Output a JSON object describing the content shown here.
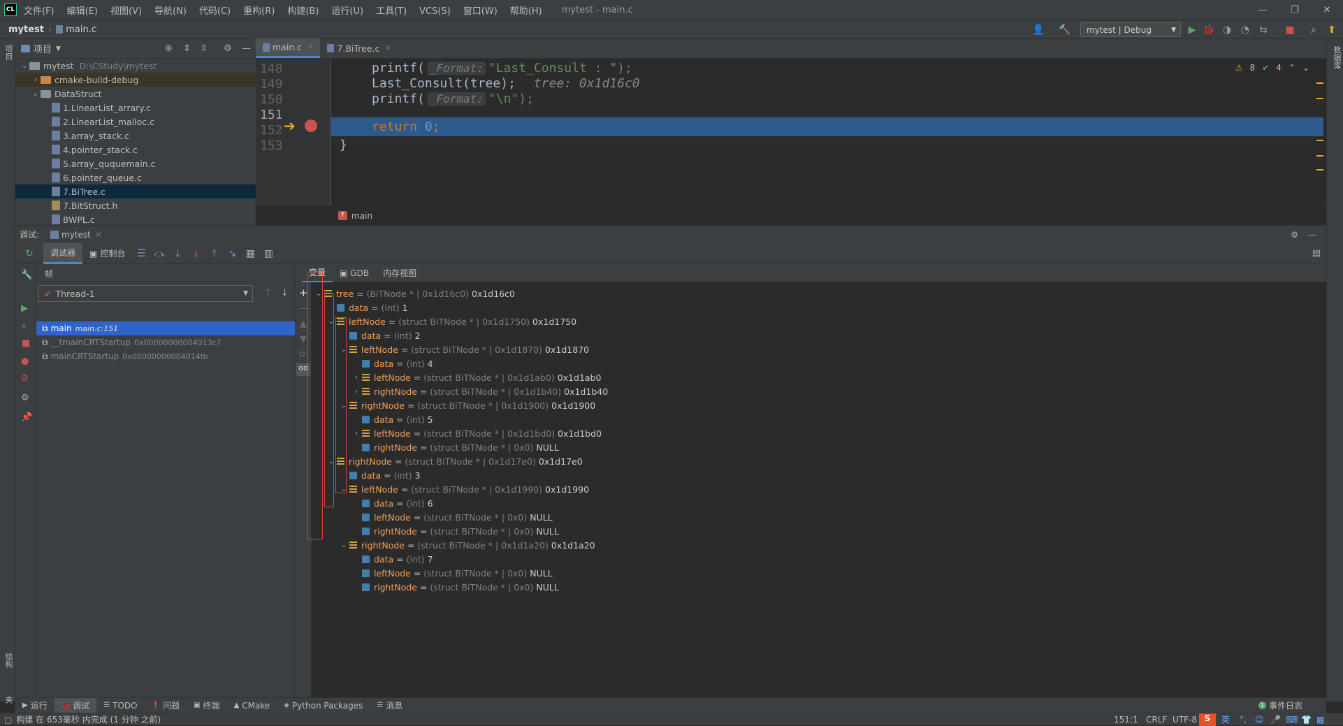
{
  "window": {
    "menu": [
      "文件(F)",
      "编辑(E)",
      "视图(V)",
      "导航(N)",
      "代码(C)",
      "重构(R)",
      "构建(B)",
      "运行(U)",
      "工具(T)",
      "VCS(S)",
      "窗口(W)",
      "帮助(H)"
    ],
    "title": "mytest - main.c"
  },
  "navbar": {
    "project": "mytest",
    "file": "main.c",
    "run_config": "mytest | Debug"
  },
  "project_panel": {
    "title": "项目",
    "root_name": "mytest",
    "root_path": "D:\\CStudy\\mytest",
    "items": [
      {
        "label": "cmake-build-debug",
        "type": "folder-orange",
        "indent": 1,
        "fold": "›"
      },
      {
        "label": "DataStruct",
        "type": "folder",
        "indent": 1,
        "fold": "⌄"
      },
      {
        "label": "1.LinearList_arrary.c",
        "type": "c",
        "indent": 2
      },
      {
        "label": "2.LinearList_malloc.c",
        "type": "c",
        "indent": 2
      },
      {
        "label": "3.array_stack.c",
        "type": "c",
        "indent": 2
      },
      {
        "label": "4.pointer_stack.c",
        "type": "c",
        "indent": 2
      },
      {
        "label": "5.array_ququemain.c",
        "type": "c",
        "indent": 2
      },
      {
        "label": "6.pointer_queue.c",
        "type": "c",
        "indent": 2
      },
      {
        "label": "7.BiTree.c",
        "type": "c",
        "indent": 2,
        "selected": true
      },
      {
        "label": "7.BitStruct.h",
        "type": "h",
        "indent": 2
      },
      {
        "label": "8WPL.c",
        "type": "c",
        "indent": 2
      }
    ]
  },
  "editor": {
    "tabs": [
      "main.c",
      "7.BiTree.c"
    ],
    "warnings": "8",
    "checks": "4",
    "line_numbers": [
      "148",
      "149",
      "150",
      "151",
      "152",
      "153"
    ],
    "code": {
      "l148_a": "printf(",
      "l148_hint": "_Format:",
      "l148_b": "\"Last_Consult : \");",
      "l149_a": "Last_Consult(tree);",
      "l149_inline": "tree: 0x1d16c0",
      "l150_a": "printf(",
      "l150_hint": "_Format:",
      "l150_b": "\"\\n\");",
      "l151_kw": "return",
      "l151_num": "0",
      "l151_end": ";",
      "l152": "}"
    },
    "breadcrumb": "main"
  },
  "debug": {
    "title": "调试:",
    "session": "mytest",
    "tabs": [
      "调试器",
      "控制台"
    ],
    "frames_label": "帧",
    "thread": "Thread-1",
    "frames": [
      {
        "name": "main",
        "loc": "main.c:151",
        "selected": true
      },
      {
        "name": "__tmainCRTStartup",
        "loc": "0x00000000004013c7"
      },
      {
        "name": "mainCRTStartup",
        "loc": "0x00000000004014fb"
      }
    ],
    "var_tabs": [
      "变量",
      "GDB",
      "内存视图"
    ],
    "vars": [
      {
        "d": 0,
        "chev": "⌄",
        "icon": "struct",
        "name": "tree",
        "type": "(BiTNode * | 0x1d16c0)",
        "val": "0x1d16c0"
      },
      {
        "d": 1,
        "chev": "",
        "icon": "field",
        "name": "data",
        "type": "(int)",
        "val": "1"
      },
      {
        "d": 1,
        "chev": "⌄",
        "icon": "struct",
        "name": "leftNode",
        "type": "(struct BiTNode * | 0x1d1750)",
        "val": "0x1d1750"
      },
      {
        "d": 2,
        "chev": "",
        "icon": "field",
        "name": "data",
        "type": "(int)",
        "val": "2"
      },
      {
        "d": 2,
        "chev": "⌄",
        "icon": "struct",
        "name": "leftNode",
        "type": "(struct BiTNode * | 0x1d1870)",
        "val": "0x1d1870"
      },
      {
        "d": 3,
        "chev": "",
        "icon": "field",
        "name": "data",
        "type": "(int)",
        "val": "4"
      },
      {
        "d": 3,
        "chev": "›",
        "icon": "struct",
        "name": "leftNode",
        "type": "(struct BiTNode * | 0x1d1ab0)",
        "val": "0x1d1ab0"
      },
      {
        "d": 3,
        "chev": "›",
        "icon": "struct",
        "name": "rightNode",
        "type": "(struct BiTNode * | 0x1d1b40)",
        "val": "0x1d1b40"
      },
      {
        "d": 2,
        "chev": "⌄",
        "icon": "struct",
        "name": "rightNode",
        "type": "(struct BiTNode * | 0x1d1900)",
        "val": "0x1d1900"
      },
      {
        "d": 3,
        "chev": "",
        "icon": "field",
        "name": "data",
        "type": "(int)",
        "val": "5"
      },
      {
        "d": 3,
        "chev": "›",
        "icon": "struct",
        "name": "leftNode",
        "type": "(struct BiTNode * | 0x1d1bd0)",
        "val": "0x1d1bd0"
      },
      {
        "d": 3,
        "chev": "",
        "icon": "field",
        "name": "rightNode",
        "type": "(struct BiTNode * | 0x0)",
        "val": "NULL"
      },
      {
        "d": 1,
        "chev": "⌄",
        "icon": "struct",
        "name": "rightNode",
        "type": "(struct BiTNode * | 0x1d17e0)",
        "val": "0x1d17e0"
      },
      {
        "d": 2,
        "chev": "",
        "icon": "field",
        "name": "data",
        "type": "(int)",
        "val": "3"
      },
      {
        "d": 2,
        "chev": "⌄",
        "icon": "struct",
        "name": "leftNode",
        "type": "(struct BiTNode * | 0x1d1990)",
        "val": "0x1d1990"
      },
      {
        "d": 3,
        "chev": "",
        "icon": "field",
        "name": "data",
        "type": "(int)",
        "val": "6"
      },
      {
        "d": 3,
        "chev": "",
        "icon": "field",
        "name": "leftNode",
        "type": "(struct BiTNode * | 0x0)",
        "val": "NULL"
      },
      {
        "d": 3,
        "chev": "",
        "icon": "field",
        "name": "rightNode",
        "type": "(struct BiTNode * | 0x0)",
        "val": "NULL"
      },
      {
        "d": 2,
        "chev": "⌄",
        "icon": "struct",
        "name": "rightNode",
        "type": "(struct BiTNode * | 0x1d1a20)",
        "val": "0x1d1a20"
      },
      {
        "d": 3,
        "chev": "",
        "icon": "field",
        "name": "data",
        "type": "(int)",
        "val": "7"
      },
      {
        "d": 3,
        "chev": "",
        "icon": "field",
        "name": "leftNode",
        "type": "(struct BiTNode * | 0x0)",
        "val": "NULL"
      },
      {
        "d": 3,
        "chev": "",
        "icon": "field",
        "name": "rightNode",
        "type": "(struct BiTNode * | 0x0)",
        "val": "NULL"
      }
    ]
  },
  "bottom_tabs": [
    "运行",
    "调试",
    "TODO",
    "问题",
    "终端",
    "CMake",
    "Python Packages",
    "消息"
  ],
  "event_log": "事件日志",
  "status": {
    "message": "构建 在 653毫秒 内完成 (1 分钟 之前)",
    "position": "151:1",
    "line_sep": "CRLF",
    "encoding": "UTF-8",
    "ime": "英"
  },
  "side_labels": {
    "left_top": "项目",
    "left_structure": "结构",
    "left_favorites": "收藏夹",
    "right": "数据库"
  },
  "colors": {
    "accent": "#4a88c7",
    "highlight_line": "#2d5a8c",
    "var_name": "#ef9f5a",
    "annotation_box": "#d94343"
  }
}
